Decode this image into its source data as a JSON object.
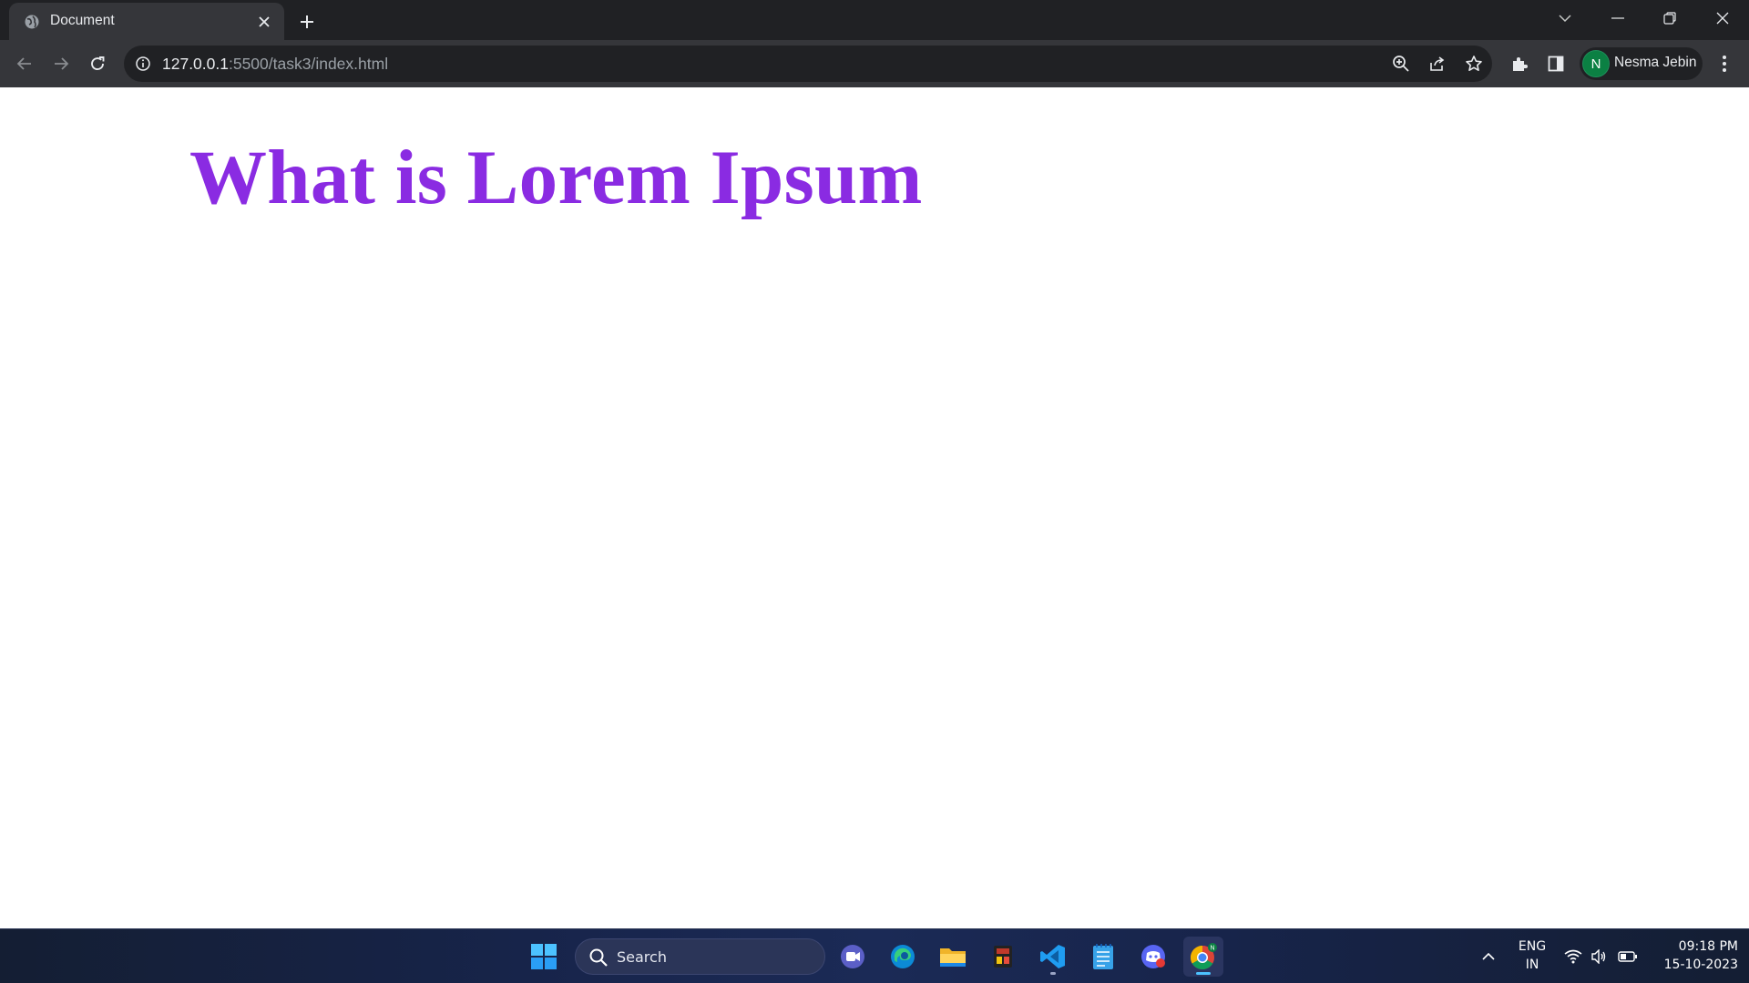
{
  "browser": {
    "tab": {
      "title": "Document",
      "favicon": "globe-icon"
    },
    "url_host": "127.0.0.1",
    "url_path": ":5500/task3/index.html",
    "profile": {
      "initial": "N",
      "name": "Nesma Jebin"
    },
    "colors": {
      "tabbar": "#202124",
      "toolbar": "#35363a",
      "omnibox": "#202124"
    }
  },
  "page": {
    "heading": "What is Lorem Ipsum",
    "heading_color": "#8a2be2"
  },
  "taskbar": {
    "search_label": "Search",
    "apps": [
      "meet-icon",
      "edge-icon",
      "file-explorer-icon",
      "media-player-icon",
      "vscode-icon",
      "notepad-icon",
      "discord-icon",
      "chrome-icon"
    ],
    "active_app": "chrome-icon",
    "language": {
      "line1": "ENG",
      "line2": "IN"
    },
    "clock": {
      "time": "09:18 PM",
      "date": "15-10-2023"
    }
  }
}
